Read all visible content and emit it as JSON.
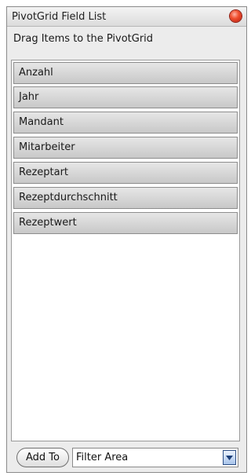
{
  "window": {
    "title": "PivotGrid Field List",
    "close_icon": "close-icon"
  },
  "hint": "Drag Items to the PivotGrid",
  "fields": [
    "Anzahl",
    "Jahr",
    "Mandant",
    "Mitarbeiter",
    "Rezeptart",
    "Rezeptdurchschnitt",
    "Rezeptwert"
  ],
  "footer": {
    "add_to_label": "Add To",
    "area_value": "Filter Area"
  },
  "colors": {
    "close": "#e0301c",
    "dropdown_arrow": "#1c3f7a"
  }
}
